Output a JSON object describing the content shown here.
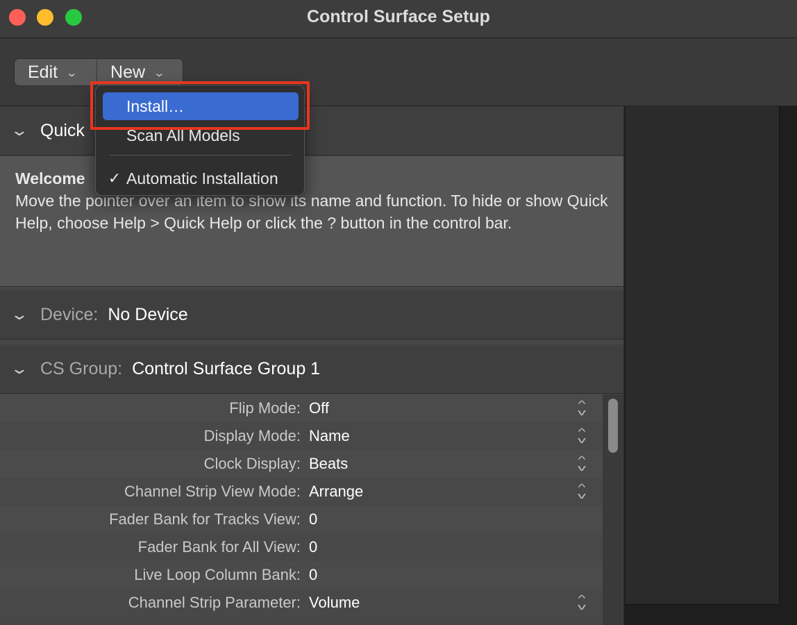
{
  "window": {
    "title": "Control Surface Setup"
  },
  "toolbar": {
    "edit_label": "Edit",
    "new_label": "New"
  },
  "quick_help": {
    "header_label": "Quick",
    "title": "Welcome",
    "body": "Move the pointer over an item to show its name and function. To hide or show Quick Help, choose Help > Quick Help or click the ? button in the control bar."
  },
  "device": {
    "label": "Device:",
    "value": "No Device"
  },
  "cs_group": {
    "label": "CS Group:",
    "value": "Control Surface Group 1"
  },
  "parameters": [
    {
      "label": "Flip Mode:",
      "value": "Off",
      "has_stepper": true
    },
    {
      "label": "Display Mode:",
      "value": "Name",
      "has_stepper": true
    },
    {
      "label": "Clock Display:",
      "value": "Beats",
      "has_stepper": true
    },
    {
      "label": "Channel Strip View Mode:",
      "value": "Arrange",
      "has_stepper": true
    },
    {
      "label": "Fader Bank for Tracks View:",
      "value": "0",
      "has_stepper": false
    },
    {
      "label": "Fader Bank for All View:",
      "value": "0",
      "has_stepper": false
    },
    {
      "label": "Live Loop Column Bank:",
      "value": "0",
      "has_stepper": false
    },
    {
      "label": "Channel Strip Parameter:",
      "value": "Volume",
      "has_stepper": true
    }
  ],
  "new_menu": {
    "items": [
      {
        "label": "Install…",
        "highlighted": true
      },
      {
        "label": "Scan All Models",
        "highlighted": false
      },
      {
        "label": "Automatic Installation",
        "checked": true
      }
    ]
  },
  "colors": {
    "highlight_box": "#e8351e",
    "menu_selection": "#3a6bd1"
  }
}
